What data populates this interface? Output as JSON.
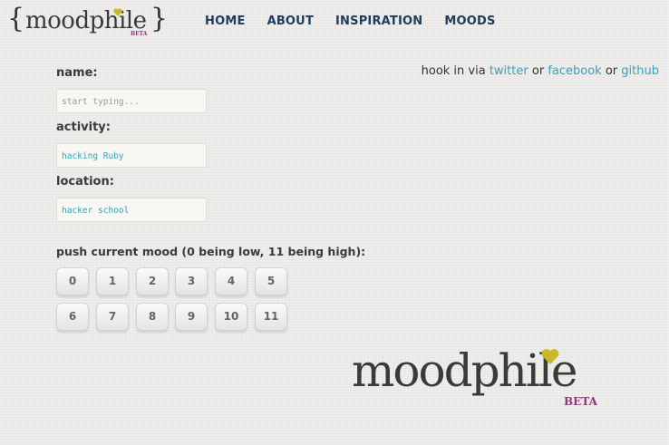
{
  "logo": {
    "text": "moodphile",
    "beta": "BETA",
    "brace_left": "{",
    "brace_right": "}",
    "heart_color": "#c9b82a"
  },
  "nav": {
    "home": "HOME",
    "about": "ABOUT",
    "inspiration": "INSPIRATION",
    "moods": "MOODS"
  },
  "hook": {
    "prefix": "hook in via",
    "twitter": "twitter",
    "or1": "or",
    "facebook": "facebook",
    "or2": "or",
    "github": "github"
  },
  "form": {
    "name_label": "name:",
    "name_placeholder": "start typing...",
    "activity_label": "activity:",
    "activity_value": "hacking Ruby",
    "location_label": "location:",
    "location_value": "hacker school"
  },
  "mood": {
    "label": "push current mood (0 being low, 11 being high):",
    "buttons": [
      "0",
      "1",
      "2",
      "3",
      "4",
      "5",
      "6",
      "7",
      "8",
      "9",
      "10",
      "11"
    ]
  },
  "footer_logo": {
    "text": "moodphile",
    "beta": "BETA"
  },
  "colors": {
    "nav": "#1f3b5e",
    "link": "#3aa0b8",
    "beta": "#8a3a7a",
    "heart": "#c9b82a"
  }
}
